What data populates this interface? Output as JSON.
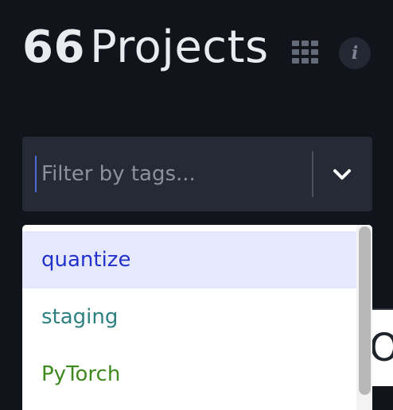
{
  "header": {
    "count": "66",
    "title_word": "Projects"
  },
  "icons": {
    "grid": "grid-view-icon",
    "info": "info-icon",
    "info_glyph": "i",
    "chevron": "chevron-down-icon"
  },
  "filter": {
    "placeholder": "Filter by tags...",
    "value": ""
  },
  "dropdown": {
    "options": [
      {
        "label": "quantize",
        "color": "#2233cc",
        "highlighted": true
      },
      {
        "label": "staging",
        "color": "#2f8080",
        "highlighted": false
      },
      {
        "label": "PyTorch",
        "color": "#3f8a1f",
        "highlighted": false
      }
    ]
  },
  "background": {
    "partial_text": "O"
  },
  "colors": {
    "page_bg": "#11141b",
    "filter_bg": "#252a35",
    "highlight_bg": "#e6e9fd"
  }
}
